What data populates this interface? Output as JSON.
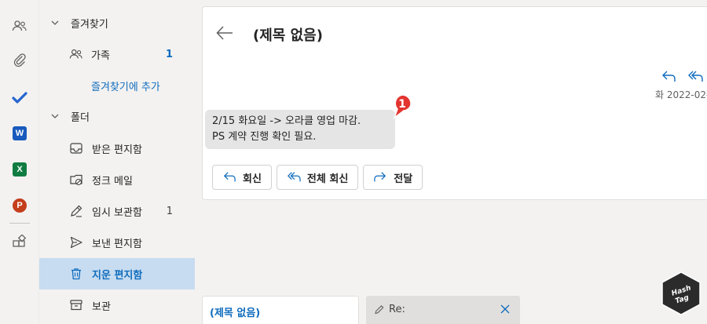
{
  "favorites": {
    "header": "즐겨찾기",
    "items": [
      {
        "label": "가족",
        "count": "1"
      }
    ],
    "add_link": "즐겨찾기에 추가"
  },
  "folders": {
    "header": "폴더",
    "items": [
      {
        "label": "받은 편지함",
        "count": ""
      },
      {
        "label": "정크 메일",
        "count": ""
      },
      {
        "label": "임시 보관함",
        "count": "1"
      },
      {
        "label": "보낸 편지함",
        "count": ""
      },
      {
        "label": "지운 편지함",
        "count": ""
      },
      {
        "label": "보관",
        "count": ""
      }
    ]
  },
  "message": {
    "subject": "(제목 없음)",
    "date": "화 2022-02-",
    "body_line1": "2/15 화요일 -> 오라클 영업 마감.",
    "body_line2": "PS 계약 진행 확인 필요.",
    "marker_number": "1"
  },
  "actions": {
    "reply": "회신",
    "reply_all": "전체 회신",
    "forward": "전달"
  },
  "tabs": {
    "tab1": "(제목 없음)",
    "tab2": "Re:"
  },
  "watermark": {
    "line1": "Hash",
    "line2": "Tag"
  },
  "colors": {
    "accent": "#0f6cbd",
    "selected_bg": "#c7dcf0",
    "marker": "#e3342f",
    "word": "#185abd",
    "excel": "#107c41",
    "powerpoint": "#c43e1c",
    "todo": "#2564cf"
  },
  "icons": {
    "rail": [
      "people-icon",
      "paperclip-icon",
      "todo-check-icon",
      "word-icon",
      "excel-icon",
      "powerpoint-icon",
      "apps-icon"
    ]
  }
}
